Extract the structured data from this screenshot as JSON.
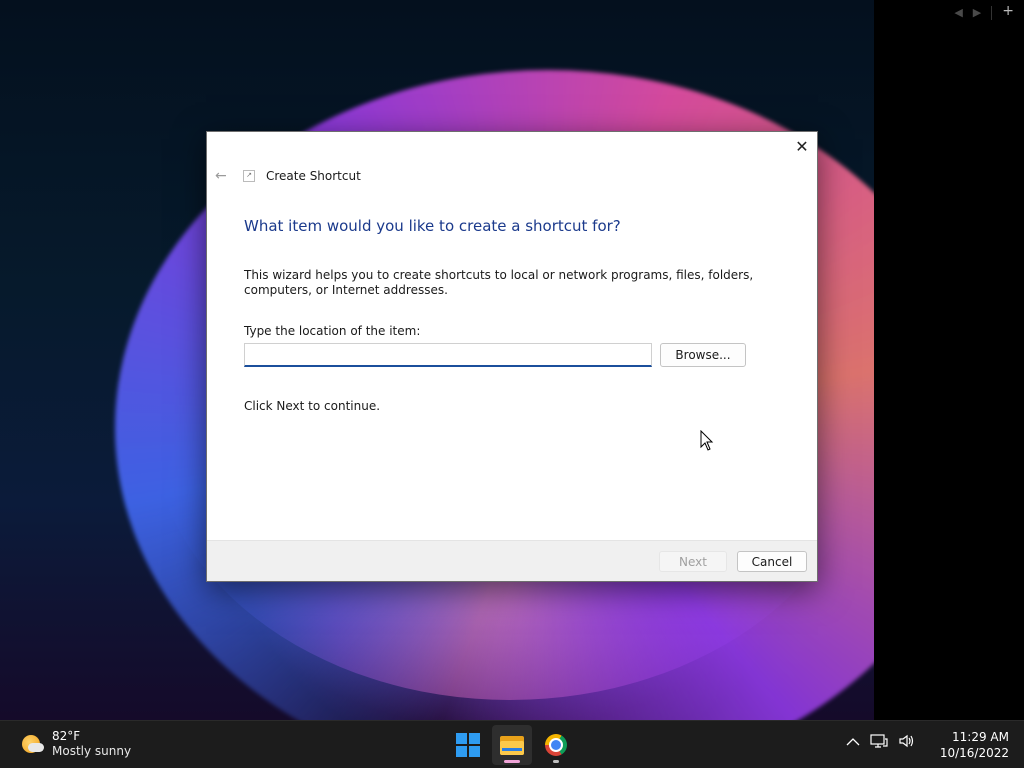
{
  "right_panel": {
    "prev": "◀",
    "next": "▶",
    "add": "+"
  },
  "dialog": {
    "close": "✕",
    "back": "←",
    "icon": "wizard-icon",
    "title": "Create Shortcut",
    "question": "What item would you like to create a shortcut for?",
    "description": "This wizard helps you to create shortcuts to local or network programs, files, folders, computers, or Internet addresses.",
    "location_label": "Type the location of the item:",
    "location_value": "",
    "browse_label": "Browse...",
    "continue_text": "Click Next to continue.",
    "next_label": "Next",
    "cancel_label": "Cancel"
  },
  "taskbar": {
    "weather": {
      "icon": "partly-sunny-icon",
      "temperature": "82°F",
      "condition": "Mostly sunny"
    },
    "pinned": [
      {
        "name": "start",
        "icon": "windows-logo-icon"
      },
      {
        "name": "file-explorer",
        "icon": "folder-icon",
        "active": true,
        "indicator_color": "#f0a4d8"
      },
      {
        "name": "chrome",
        "icon": "chrome-icon",
        "indicator_color": "#bfbfbf"
      }
    ],
    "tray": {
      "chevron": "^",
      "network": "🖥",
      "volume": "🔊"
    },
    "clock": {
      "time": "11:29 AM",
      "date": "10/16/2022"
    }
  }
}
